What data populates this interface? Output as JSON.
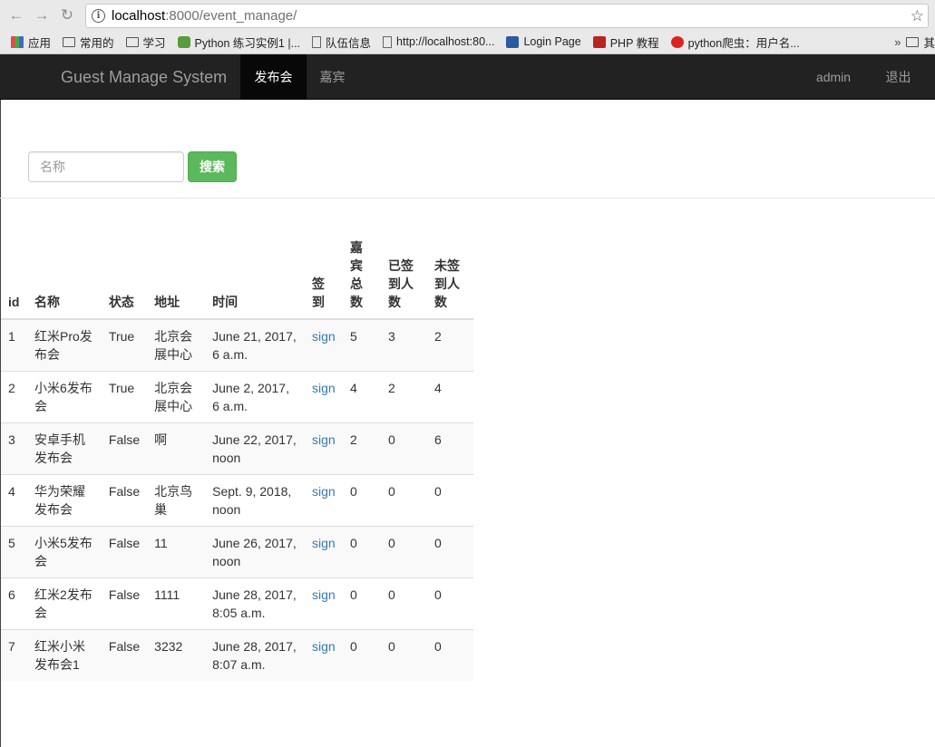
{
  "browser": {
    "url_host": "localhost",
    "url_rest": ":8000/event_manage/",
    "bookmarks": [
      {
        "label": "应用",
        "icon": "apps-icon"
      },
      {
        "label": "常用的",
        "icon": "folder-icon"
      },
      {
        "label": "学习",
        "icon": "folder-icon"
      },
      {
        "label": "Python 练习实例1 |...",
        "icon": "python-icon"
      },
      {
        "label": "队伍信息",
        "icon": "page-icon"
      },
      {
        "label": "http://localhost:80...",
        "icon": "page-icon"
      },
      {
        "label": "Login Page",
        "icon": "login-icon"
      },
      {
        "label": "PHP 教程",
        "icon": "w3-icon"
      },
      {
        "label": "python爬虫：用户名...",
        "icon": "c-icon"
      }
    ],
    "bookmarks_more": "其",
    "bookmarks_more_chevron": "»"
  },
  "navbar": {
    "brand": "Guest Manage System",
    "tabs": [
      {
        "label": "发布会",
        "active": true
      },
      {
        "label": "嘉宾",
        "active": false
      }
    ],
    "user": "admin",
    "logout": "退出"
  },
  "search": {
    "placeholder": "名称",
    "button": "搜索"
  },
  "table": {
    "headers": {
      "id": "id",
      "name": "名称",
      "status": "状态",
      "address": "地址",
      "time": "时间",
      "sign": "签到",
      "total": "嘉宾总数",
      "signed": "已签到人数",
      "unsigned": "未签到人数"
    },
    "rows": [
      {
        "id": "1",
        "name": "红米Pro发布会",
        "status": "True",
        "address": "北京会展中心",
        "time": "June 21, 2017, 6 a.m.",
        "sign": "sign",
        "total": "5",
        "signed": "3",
        "unsigned": "2"
      },
      {
        "id": "2",
        "name": "小米6发布会",
        "status": "True",
        "address": "北京会展中心",
        "time": "June 2, 2017, 6 a.m.",
        "sign": "sign",
        "total": "4",
        "signed": "2",
        "unsigned": "4"
      },
      {
        "id": "3",
        "name": "安卓手机发布会",
        "status": "False",
        "address": "啊",
        "time": "June 22, 2017, noon",
        "sign": "sign",
        "total": "2",
        "signed": "0",
        "unsigned": "6"
      },
      {
        "id": "4",
        "name": "华为荣耀发布会",
        "status": "False",
        "address": "北京鸟巢",
        "time": "Sept. 9, 2018, noon",
        "sign": "sign",
        "total": "0",
        "signed": "0",
        "unsigned": "0"
      },
      {
        "id": "5",
        "name": "小米5发布会",
        "status": "False",
        "address": "11",
        "time": "June 26, 2017, noon",
        "sign": "sign",
        "total": "0",
        "signed": "0",
        "unsigned": "0"
      },
      {
        "id": "6",
        "name": "红米2发布会",
        "status": "False",
        "address": "1111",
        "time": "June 28, 2017, 8:05 a.m.",
        "sign": "sign",
        "total": "0",
        "signed": "0",
        "unsigned": "0"
      },
      {
        "id": "7",
        "name": "红米小米发布会1",
        "status": "False",
        "address": "3232",
        "time": "June 28, 2017, 8:07 a.m.",
        "sign": "sign",
        "total": "0",
        "signed": "0",
        "unsigned": "0"
      }
    ]
  }
}
